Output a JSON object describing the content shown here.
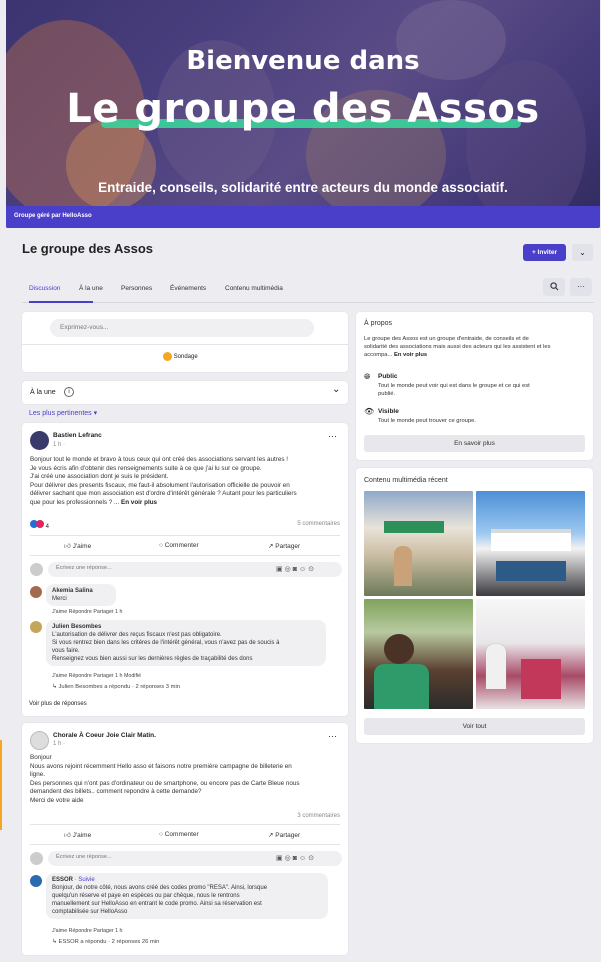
{
  "banner": {
    "title_line1": "Bienvenue dans",
    "title_line2": "Le groupe des Assos",
    "subtitle": "Entraide, conseils, solidarité entre acteurs du monde associatif.",
    "managed_by": "Groupe géré par HelloAsso"
  },
  "group": {
    "name": "Le groupe des Assos",
    "invite_label": "+ Inviter",
    "dropdown": "⌄"
  },
  "tabs": [
    {
      "label": "Discussion"
    },
    {
      "label": "À la une"
    },
    {
      "label": "Personnes"
    },
    {
      "label": "Événements"
    },
    {
      "label": "Contenu multimédia"
    }
  ],
  "composer": {
    "placeholder": "Exprimez-vous...",
    "poll_label": "Sondage"
  },
  "featured": {
    "label": "À la une",
    "info": "i",
    "chevron": "⌄"
  },
  "sort": {
    "label": "Les plus pertinentes ▾"
  },
  "post1": {
    "author": "Bastien Lefranc",
    "time": "1 h · ",
    "text_lines": [
      "Bonjour tout le monde et bravo à tous ceux qui ont créé des associations servant les autres !",
      "Je vous écris afin d'obtenir des renseignements suite à ce que j'ai lu sur ce groupe.",
      "J'ai créé une association dont je suis le président.",
      "Pour délivrer des presents fiscaux, me faut-il absolument l'autorisation officielle de pouvoir en",
      "délivrer sachant que mon association est d'ordre d'intérêt générale ? Autant pour les particuliers",
      "que pour les professionnels ? ..."
    ],
    "see_more": "En voir plus",
    "reactions": "4",
    "comments": "5 commentaires",
    "like": "J'aime",
    "comment": "Commenter",
    "share": "Partager",
    "reply_placeholder": "Écrivez une réponse...",
    "c1": {
      "author": "Akemia Salina",
      "text": "Merci",
      "actions": "J'aime   Répondre   Partager   1 h"
    },
    "c2": {
      "author": "Julien Besombes",
      "lines": [
        "L'autorisation de délivrer des reçus fiscaux n'est pas obligatoire.",
        "Si vous rentrez bien dans les critères de l'intérêt général, vous n'avez pas de soucis à",
        "vous faire.",
        "Renseignez vous bien aussi sur les dernières règles de traçabilité des dons"
      ],
      "actions": "J'aime   Répondre   Partager   1 h   Modifié",
      "replied": "Julien Besombes a répondu · 2 réponses 3 min"
    },
    "see_replies": "Voir plus de réponses"
  },
  "post2": {
    "author": "Chorale À Coeur Joie Clair Matin.",
    "time": "1 h · ",
    "text_lines": [
      "Bonjour",
      "Nous avons rejoint récemment Hello asso et faisons notre première campagne de billeterie en",
      "ligne.",
      "Des personnes qui n'ont pas d'ordinateur ou de smartphone,  ou encore pas de Carte Bleue nous",
      "demandent  des billets.. comment repondre à cette demande?",
      "Merci de votre aide"
    ],
    "comments": "3 commentaires",
    "like": "J'aime",
    "comment": "Commenter",
    "share": "Partager",
    "reply_placeholder": "Écrivez une réponse...",
    "c1": {
      "author": "ESSOR",
      "tag": " · Suivie",
      "lines": [
        "Bonjour, de notre côté, nous avons créé des codes promo \"RESA\". Ainsi, lorsque",
        "quelqu'un réserve et paye en espèces ou par chèque, nous le rentrons",
        "manuellement sur HelloAsso en entrant le code promo. Ainsi sa réservation est",
        "comptabilisée sur HelloAsso"
      ],
      "actions": "J'aime   Répondre   Partager   1 h",
      "replied": "ESSOR a répondu · 2 réponses 26 min"
    }
  },
  "about": {
    "title": "À propos",
    "lines": [
      "Le groupe des Assos est un groupe d'entraide, de conseils et de",
      "solidarité des associations mais aussi des acteurs qui les assistent et les",
      "accompa..."
    ],
    "see_more": "En voir plus",
    "public_title": "Public",
    "public_desc": [
      "Tout le monde peut voir qui est dans le groupe et ce qui est",
      "publié."
    ],
    "visible_title": "Visible",
    "visible_desc": "Tout le monde peut trouver ce groupe.",
    "learn_more": "En savoir plus"
  },
  "media": {
    "title": "Contenu multimédia récent",
    "see_all": "Voir tout"
  }
}
